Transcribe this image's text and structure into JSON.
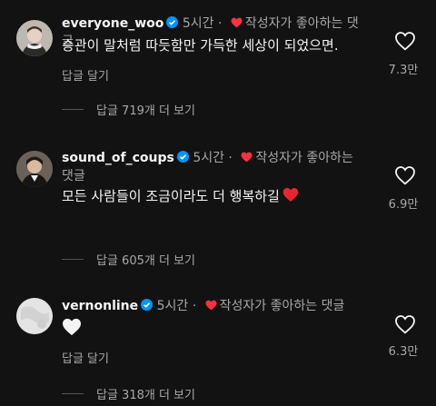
{
  "comments": [
    {
      "username": "everyone_woo",
      "time": "5시간",
      "creator_liked": "작성자가 좋아하는 댓글",
      "text": "승관이 말처럼 따듯함만 가득한 세상이 되었으면.",
      "reply_label": "답글 달기",
      "likes": "7.3만",
      "more_replies": "답글 719개 더 보기"
    },
    {
      "username": "sound_of_coups",
      "time": "5시간",
      "creator_liked": "작성자가 좋아하는 댓글",
      "text": "모든 사람들이 조금이라도 더 행복하길",
      "likes": "6.9만",
      "more_replies": "답글 605개 더 보기"
    },
    {
      "username": "vernonline",
      "time": "5시간",
      "creator_liked": "작성자가 좋아하는 댓글",
      "reply_label": "답글 달기",
      "likes": "6.3만",
      "more_replies": "답글 318개 더 보기"
    }
  ],
  "colors": {
    "background": "#121212",
    "verified": "#0095f6",
    "heart_red": "#ff3040",
    "muted_text": "#a8a8a8"
  },
  "icons": {
    "verified": "verified-badge-icon",
    "creator_heart": "red-heart-icon",
    "like": "heart-outline-icon",
    "emoji_red_heart": "red-heart-emoji",
    "emoji_white_heart": "white-heart-emoji"
  }
}
